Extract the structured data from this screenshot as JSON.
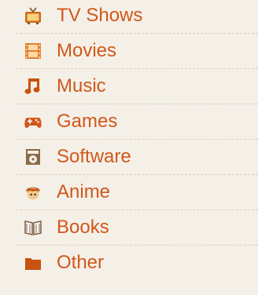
{
  "categories": [
    {
      "label": "TV Shows",
      "icon": "tv-icon"
    },
    {
      "label": "Movies",
      "icon": "film-icon"
    },
    {
      "label": "Music",
      "icon": "music-note-icon"
    },
    {
      "label": "Games",
      "icon": "gamepad-icon"
    },
    {
      "label": "Software",
      "icon": "software-box-icon"
    },
    {
      "label": "Anime",
      "icon": "anime-face-icon"
    },
    {
      "label": "Books",
      "icon": "book-icon"
    },
    {
      "label": "Other",
      "icon": "folder-icon"
    }
  ],
  "colors": {
    "label": "#d2571a",
    "background": "#f4f0e8",
    "separator": "#d6cfc2"
  }
}
